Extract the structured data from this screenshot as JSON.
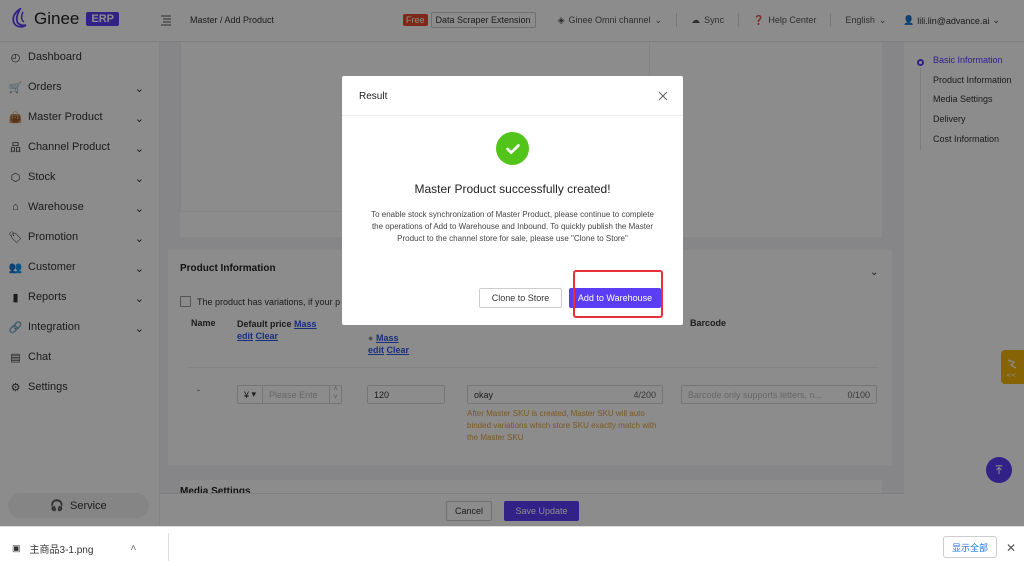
{
  "topbar": {
    "logo_text": "Ginee",
    "logo_badge": "ERP",
    "breadcrumb": "Master / Add Product",
    "free_badge": "Free",
    "scraper_label": "Data Scraper Extension",
    "omni_label": "Ginee Omni channel",
    "sync_label": "Sync",
    "help_label": "Help Center",
    "language": "English",
    "user_email": "lili.lin@advance.ai"
  },
  "sidebar": {
    "items": [
      {
        "label": "Dashboard",
        "icon": "dashboard-icon",
        "has_chevron": false
      },
      {
        "label": "Orders",
        "icon": "cart-icon",
        "has_chevron": true
      },
      {
        "label": "Master Product",
        "icon": "bag-icon",
        "has_chevron": true
      },
      {
        "label": "Channel Product",
        "icon": "sitemap-icon",
        "has_chevron": true
      },
      {
        "label": "Stock",
        "icon": "box-icon",
        "has_chevron": true
      },
      {
        "label": "Warehouse",
        "icon": "warehouse-icon",
        "has_chevron": true
      },
      {
        "label": "Promotion",
        "icon": "tag-icon",
        "has_chevron": true
      },
      {
        "label": "Customer",
        "icon": "users-icon",
        "has_chevron": true
      },
      {
        "label": "Reports",
        "icon": "bar-chart-icon",
        "has_chevron": true
      },
      {
        "label": "Integration",
        "icon": "link-icon",
        "has_chevron": true
      },
      {
        "label": "Chat",
        "icon": "chat-icon",
        "has_chevron": false
      },
      {
        "label": "Settings",
        "icon": "gear-icon",
        "has_chevron": false
      }
    ],
    "service_label": "Service"
  },
  "main": {
    "product_info_title": "Product Information",
    "variation_text": "The product has variations, if your p",
    "columns": {
      "name": "Name",
      "default_price": "Default price",
      "mass": "Mass",
      "edit": "edit",
      "clear": "Clear",
      "barcode": "Barcode"
    },
    "row": {
      "name_value": "-",
      "currency": "¥",
      "price_placeholder": "Please Ente",
      "stock_value": "120",
      "sku_value": "okay",
      "sku_count": "4/200",
      "sku_hint": "After Master SKU is created, Master SKU will auto binded variations which store SKU exactly match with the Master SKU",
      "barcode_placeholder": "Barcode only supports letters, n...",
      "barcode_count": "0/100"
    },
    "media_settings_title": "Media Settings",
    "cancel_label": "Cancel",
    "save_label": "Save Update"
  },
  "anchors": [
    {
      "label": "Basic Information",
      "active": true
    },
    {
      "label": "Product Information",
      "active": false
    },
    {
      "label": "Media Settings",
      "active": false
    },
    {
      "label": "Delivery",
      "active": false
    },
    {
      "label": "Cost Information",
      "active": false
    }
  ],
  "modal": {
    "title": "Result",
    "heading": "Master Product successfully created!",
    "body": "To enable stock synchronization of Master Product, please continue to complete the operations of Add to Warehouse and Inbound. To quickly publish the Master Product to the channel store for sale, please use \"Clone to Store\"",
    "clone_label": "Clone to Store",
    "add_label": "Add to Warehouse"
  },
  "download_bar": {
    "file_name": "主商品3-1.png",
    "show_all": "显示全部"
  },
  "colors": {
    "brand": "#5b3df5",
    "success": "#52c41a",
    "highlight": "#e8303a",
    "hint": "#e6a23c"
  }
}
